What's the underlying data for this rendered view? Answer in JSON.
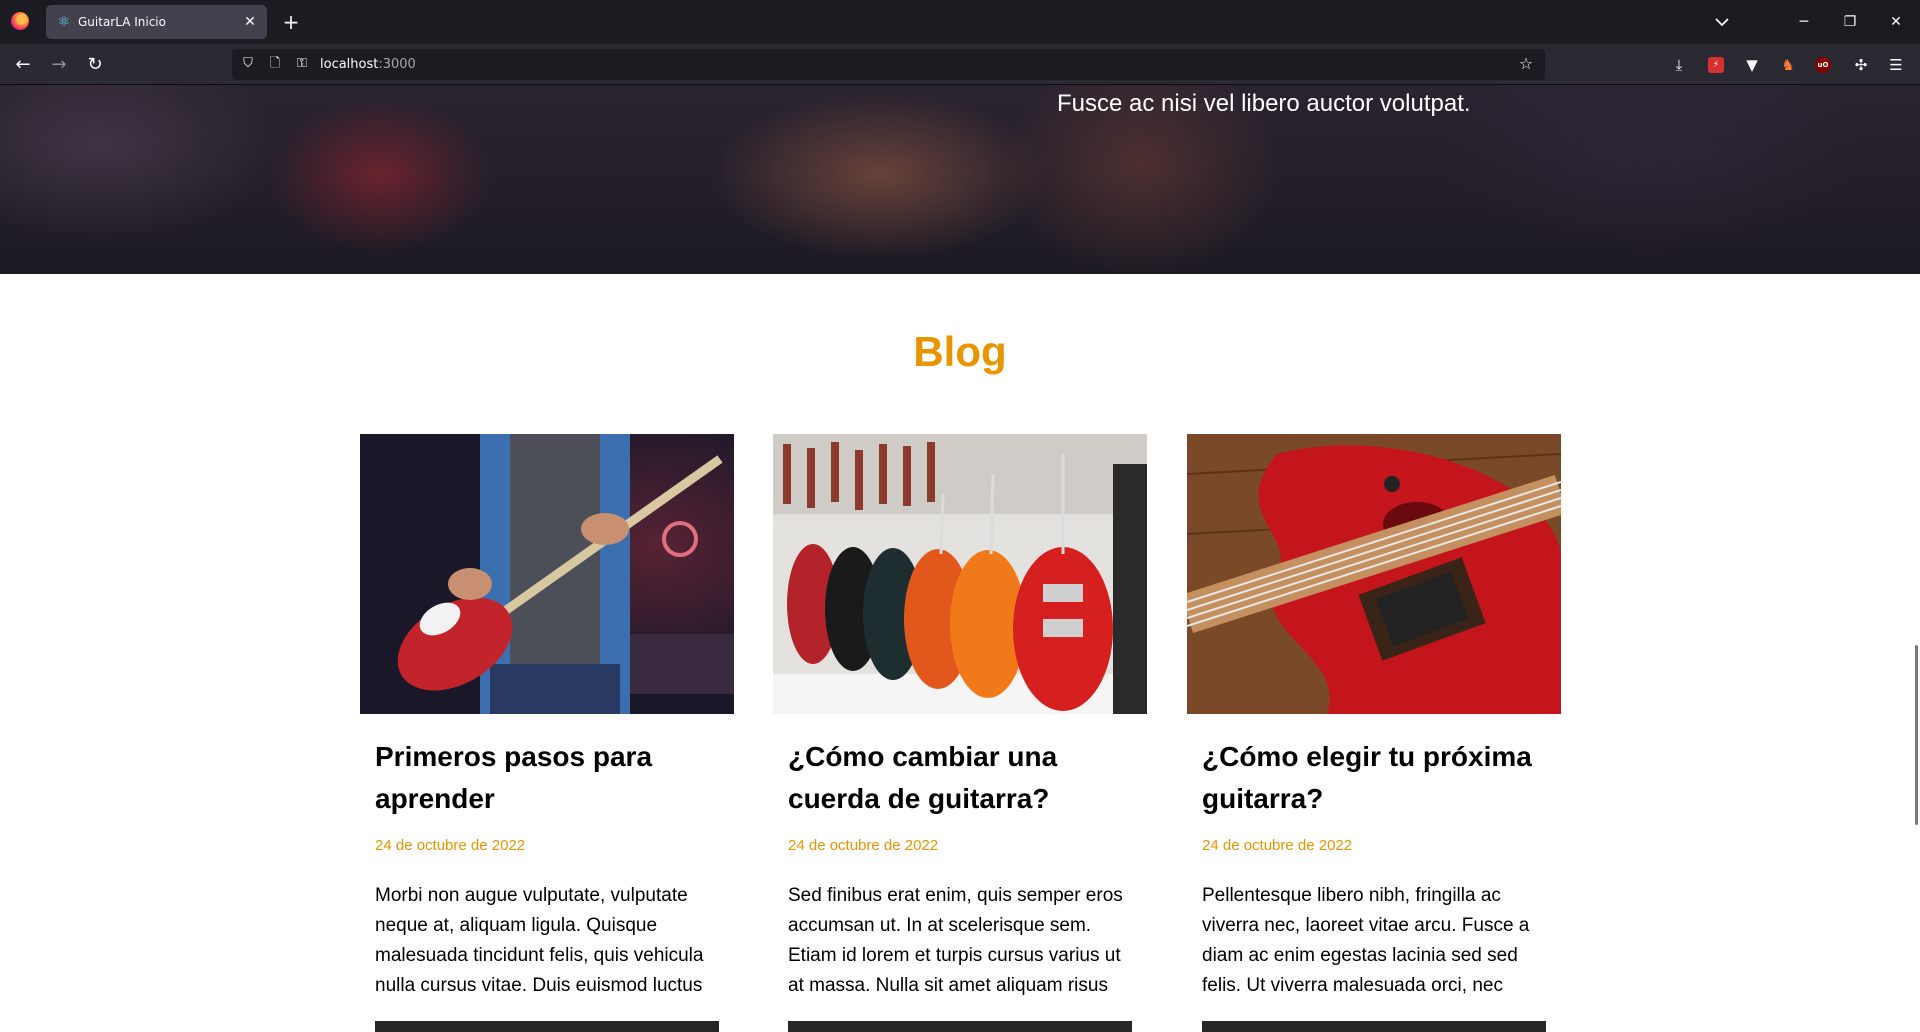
{
  "browser": {
    "tab_title": "GuitarLA Inicio",
    "tab_favicon": "react-icon",
    "url_host": "localhost",
    "url_port": ":3000"
  },
  "hero": {
    "text": "Fusce ac nisi vel libero auctor volutpat."
  },
  "blog": {
    "heading": "Blog",
    "accent_color": "#e99401",
    "posts": [
      {
        "title": "Primeros pasos para aprender",
        "date": "24 de octubre de 2022",
        "excerpt": "Morbi non augue vulputate, vulputate neque at, aliquam ligula. Quisque malesuada tincidunt felis, quis vehicula nulla cursus vitae. Duis euismod luctus"
      },
      {
        "title": "¿Cómo cambiar una cuerda de guitarra?",
        "date": "24 de octubre de 2022",
        "excerpt": "Sed finibus erat enim, quis semper eros accumsan ut. In at scelerisque sem. Etiam id lorem et turpis cursus varius ut at massa. Nulla sit amet aliquam risus"
      },
      {
        "title": "¿Cómo elegir tu próxima guitarra?",
        "date": "24 de octubre de 2022",
        "excerpt": "Pellentesque libero nibh, fringilla ac viverra nec, laoreet vitae arcu. Fusce a diam ac enim egestas lacinia sed sed felis. Ut viverra malesuada orci, nec"
      }
    ]
  }
}
